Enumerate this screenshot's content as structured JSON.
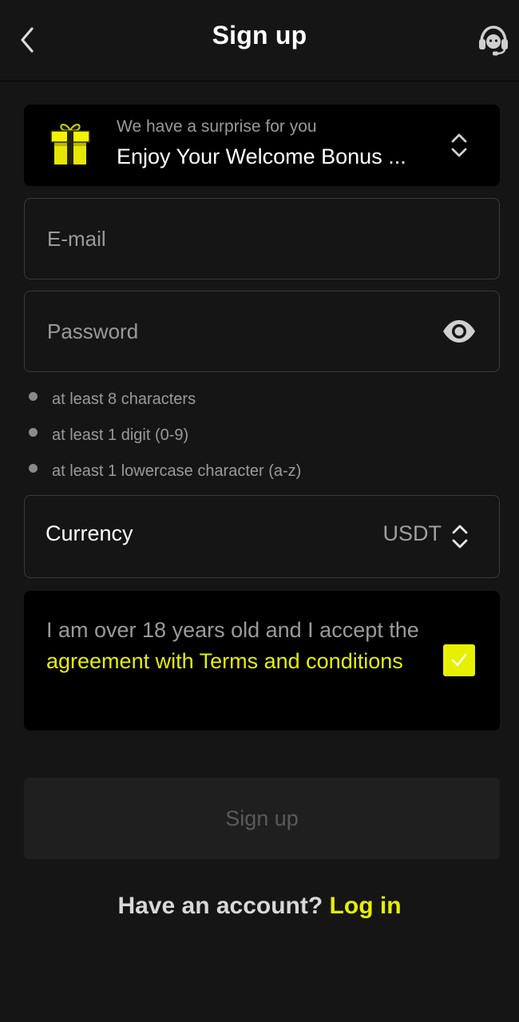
{
  "header": {
    "title": "Sign up",
    "back_icon": "chevron-left-icon",
    "support_icon": "headset-support-icon"
  },
  "bonus": {
    "subtitle": "We have a surprise for you",
    "title": "Enjoy Your Welcome Bonus ...",
    "icon": "gift-icon",
    "selector_icon": "up-down-chevron-icon"
  },
  "form": {
    "email_placeholder": "E-mail",
    "password_placeholder": "Password",
    "password_toggle_icon": "eye-icon",
    "password_rules": [
      "at least 8 characters",
      "at least 1 digit (0-9)",
      "at least 1 lowercase character (a-z)"
    ],
    "currency_label": "Currency",
    "currency_value": "USDT"
  },
  "terms": {
    "text_prefix": "I am over 18 years old and I accept the",
    "link_text": "agreement with Terms and conditions",
    "checked": true
  },
  "actions": {
    "signup_label": "Sign up"
  },
  "footer": {
    "question": "Have an account?",
    "login_label": "Log in"
  },
  "colors": {
    "background": "#151515",
    "accent": "#e6f000",
    "card": "#000000",
    "muted_text": "#9a9a9a"
  }
}
